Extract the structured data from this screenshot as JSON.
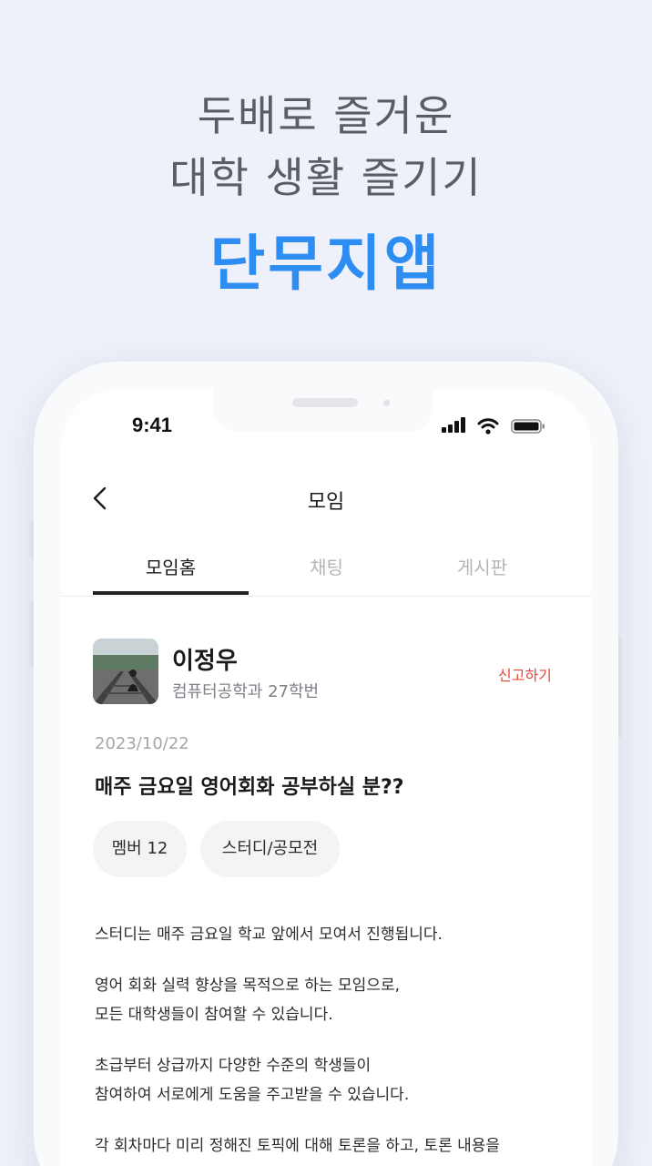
{
  "promo": {
    "line1": "두배로 즐거운",
    "line2": "대학 생활 즐기기",
    "brand": "단무지앱",
    "brand_color": "#2d8df2"
  },
  "status_bar": {
    "time": "9:41",
    "icons": [
      "signal-icon",
      "wifi-icon",
      "battery-icon"
    ]
  },
  "nav": {
    "back_icon": "chevron-left-icon",
    "title": "모임"
  },
  "tabs": [
    {
      "label": "모임홈",
      "active": true
    },
    {
      "label": "채팅",
      "active": false
    },
    {
      "label": "게시판",
      "active": false
    }
  ],
  "author": {
    "name": "이정우",
    "department": "컴퓨터공학과 27학번",
    "report_label": "신고하기",
    "report_color": "#e5483b"
  },
  "post": {
    "date": "2023/10/22",
    "title": "매주 금요일 영어회화 공부하실 분??",
    "chips": [
      "멤버 12",
      "스터디/공모전"
    ],
    "body": [
      [
        "스터디는 매주 금요일 학교 앞에서 모여서 진행됩니다."
      ],
      [
        "영어 회화 실력 향상을 목적으로 하는 모임으로,",
        "모든 대학생들이 참여할 수 있습니다."
      ],
      [
        "초급부터 상급까지 다양한 수준의 학생들이",
        "참여하여 서로에게 도움을 주고받을 수 있습니다."
      ],
      [
        "각 회차마다 미리 정해진 토픽에 대해 토론을 하고, 토론 내용을"
      ]
    ]
  }
}
